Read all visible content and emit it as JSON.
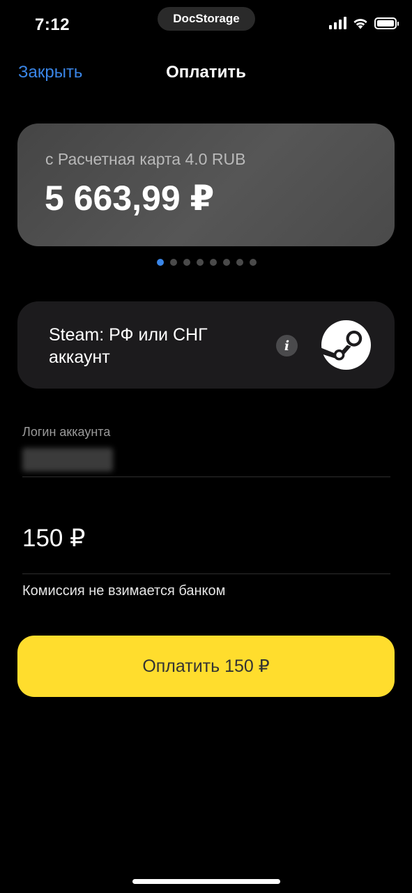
{
  "status_bar": {
    "time": "7:12",
    "island_label": "DocStorage",
    "signal_icon": "cellular-signal-icon",
    "wifi_icon": "wifi-icon",
    "battery_icon": "battery-icon",
    "battery_level": 1.0
  },
  "nav": {
    "close_label": "Закрыть",
    "title": "Оплатить"
  },
  "card": {
    "label": "с Расчетная карта 4.0 RUB",
    "balance": "5 663,99 ₽"
  },
  "pager": {
    "count": 8,
    "active_index": 0
  },
  "service": {
    "name": "Steam: РФ или СНГ аккаунт",
    "info_icon": "info-icon",
    "logo_icon": "steam-logo-icon"
  },
  "login": {
    "label": "Логин аккаунта"
  },
  "amount": {
    "value": "150 ₽"
  },
  "commission_note": "Комиссия не взимается банком",
  "pay_button": {
    "label": "Оплатить 150 ₽"
  },
  "colors": {
    "accent_blue": "#3a86e8",
    "pay_yellow": "#ffdd2d",
    "background": "#000000",
    "card_gray": "#4a4a4a",
    "service_bg": "#1c1b1d"
  }
}
